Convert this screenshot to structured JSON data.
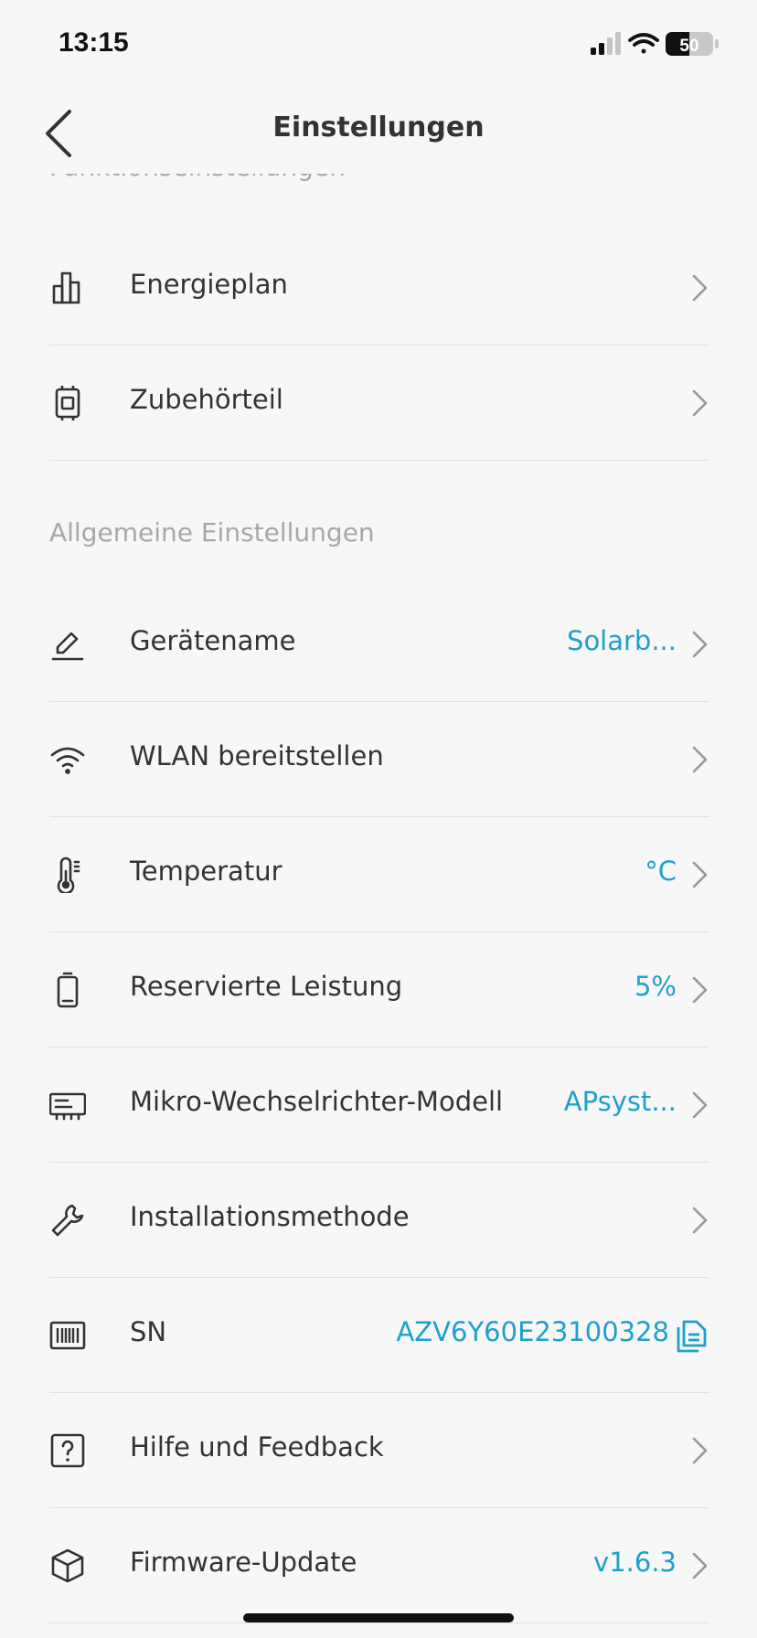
{
  "status_bar": {
    "time": "13:15",
    "battery": "50"
  },
  "nav": {
    "title": "Einstellungen"
  },
  "sections": {
    "function_settings": "Funktionseinstellungen",
    "general_settings": "Allgemeine Einstellungen"
  },
  "rows": {
    "energy_plan": {
      "label": "Energieplan",
      "icon": "bar-chart-icon"
    },
    "accessory": {
      "label": "Zubehörteil",
      "icon": "device-icon"
    },
    "device_name": {
      "label": "Gerätename",
      "value": "Solarb...",
      "icon": "pen-icon"
    },
    "wlan": {
      "label": "WLAN bereitstellen",
      "icon": "wifi-icon"
    },
    "temperature": {
      "label": "Temperatur",
      "value": "°C",
      "icon": "thermometer-icon"
    },
    "reserved_power": {
      "label": "Reservierte Leistung",
      "value": "5%",
      "icon": "battery-icon"
    },
    "micro_inverter": {
      "label": "Mikro-Wechselrichter-Modell",
      "value": "APsyst...",
      "icon": "inverter-icon"
    },
    "installation": {
      "label": "Installationsmethode",
      "icon": "wrench-icon"
    },
    "sn": {
      "label": "SN",
      "value": "AZV6Y60E23100328",
      "icon": "barcode-icon"
    },
    "help": {
      "label": "Hilfe und Feedback",
      "icon": "help-icon"
    },
    "firmware": {
      "label": "Firmware-Update",
      "value": "v1.6.3",
      "icon": "box-icon"
    }
  },
  "colors": {
    "accent": "#1ea0cc",
    "label": "#333333",
    "section": "#a8a8a8",
    "background": "#f7f7f7"
  }
}
